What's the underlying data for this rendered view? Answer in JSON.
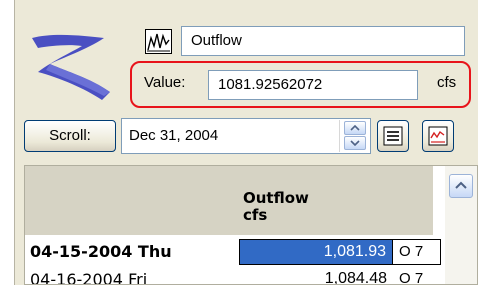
{
  "series": {
    "icon": "hydrograph-icon",
    "name": "Outflow"
  },
  "value": {
    "label": "Value:",
    "field": "1081.92562072",
    "unit": "cfs",
    "highlight_color": "#e8141b"
  },
  "scroll": {
    "button_label": "Scroll:",
    "date": "Dec 31, 2004"
  },
  "toolbar": {
    "list_icon": "list-icon",
    "chart_icon": "chart-icon"
  },
  "table": {
    "column_title": "Outflow",
    "column_unit": "cfs",
    "rows": [
      {
        "date": "04-15-2004 Thu",
        "value": "1,081.93",
        "quality": "O 7",
        "selected": true
      },
      {
        "date": "04-16-2004 Fri",
        "value": "1,084.48",
        "quality": "O 7",
        "selected": false
      }
    ]
  },
  "colors": {
    "selection": "#316ac5",
    "logo": "#4a4fc2",
    "panel": "#ece9d8"
  }
}
